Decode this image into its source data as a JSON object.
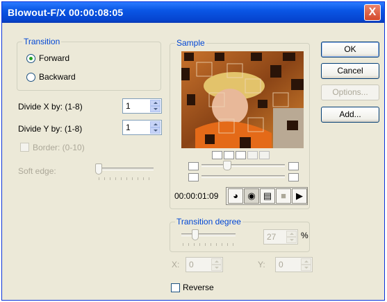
{
  "window": {
    "title": "Blowout-F/X 00:00:08:05",
    "close_glyph": "X"
  },
  "transition": {
    "legend": "Transition",
    "options": [
      {
        "label": "Forward",
        "selected": true
      },
      {
        "label": "Backward",
        "selected": false
      }
    ]
  },
  "divide_x": {
    "label": "Divide X by: (1-8)",
    "value": "1"
  },
  "divide_y": {
    "label": "Divide Y by: (1-8)",
    "value": "1"
  },
  "border": {
    "label": "Border: (0-10)",
    "checked": false,
    "enabled": false
  },
  "soft_edge": {
    "label": "Soft edge:",
    "enabled": false
  },
  "sample": {
    "legend": "Sample",
    "time": "00:00:01:09",
    "playhead_position": 0.3,
    "range_position": 0.0,
    "range_end_position": 1.0
  },
  "transition_degree": {
    "legend": "Transition degree",
    "value": "27",
    "unit": "%",
    "level": 0.27
  },
  "coords": {
    "x_label": "X:",
    "x_value": "0",
    "y_label": "Y:",
    "y_value": "0"
  },
  "reverse": {
    "label": "Reverse",
    "checked": false
  },
  "buttons": {
    "ok": "OK",
    "cancel": "Cancel",
    "options": "Options...",
    "add": "Add..."
  },
  "colors": {
    "title_bar": "#0a56e5",
    "dialog": "#ece9d8",
    "group_label": "#0046d5"
  }
}
